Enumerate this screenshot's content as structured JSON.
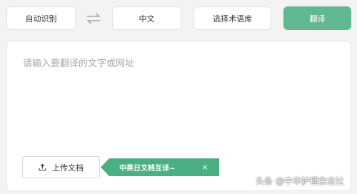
{
  "toolbar": {
    "source_language": "自动识别",
    "target_language": "中文",
    "termbase_label": "选择术语库",
    "translate_label": "翻译",
    "swap_icon": "swap-arrows-icon"
  },
  "editor": {
    "placeholder": "请输入要翻译的文字或网址",
    "value": "",
    "upload_label": "上传文档",
    "upload_icon": "upload-icon",
    "promo_text": "中英日文档互译~",
    "promo_close": "×"
  },
  "watermark": "头条 @中华护理杂志社",
  "colors": {
    "accent": "#5fb88f",
    "promo": "#4caf84",
    "background": "#f3f3f3"
  }
}
